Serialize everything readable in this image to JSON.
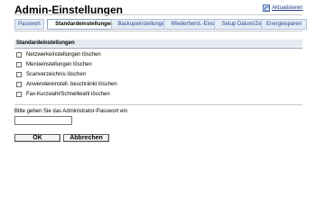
{
  "header": {
    "title": "Admin-Einstellungen",
    "refresh_label": "Aktualisieren"
  },
  "tabs": [
    {
      "label": "Passwort",
      "active": false
    },
    {
      "label": "Standardeinstellungen",
      "active": true
    },
    {
      "label": "Backupeinstellungen",
      "active": false
    },
    {
      "label": "Wiederherst.-Einst.",
      "active": false
    },
    {
      "label": "Setup Datum/Zeit",
      "active": false
    },
    {
      "label": "Energiesparen",
      "active": false
    }
  ],
  "section": {
    "title": "Standardeinstellungen",
    "options": [
      {
        "label": "Netzwerkeinstellungen löschen",
        "checked": false
      },
      {
        "label": "Menüeinstellungen löschen",
        "checked": false
      },
      {
        "label": "Scanverzeichnis löschen",
        "checked": false
      },
      {
        "label": "Anwendereinstell. beschränkt löschen",
        "checked": false
      },
      {
        "label": "Fax-Kurzwahl/Schnellwahl löschen",
        "checked": false
      }
    ]
  },
  "password": {
    "label": "Bitte geben Sie das Administrator-Passwort ein",
    "value": ""
  },
  "buttons": {
    "ok_label": "OK",
    "cancel_label": "Abbrechen"
  },
  "colors": {
    "tab_background": "#e4ebf5",
    "tab_text": "#2b4c8f",
    "section_header_background": "#e6eaf1",
    "link": "#1d3f8a"
  },
  "icons": {
    "refresh": "refresh-icon"
  }
}
